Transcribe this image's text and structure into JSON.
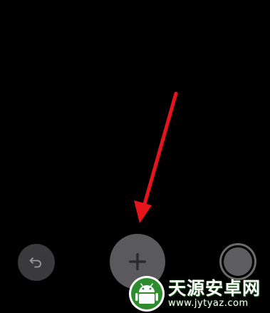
{
  "toolbar": {
    "undo": {
      "icon": "undo-arrow-icon"
    },
    "add": {
      "icon": "plus-icon"
    },
    "record": {
      "icon": "record-circle-icon"
    }
  },
  "annotation": {
    "arrow_color": "#e8141c"
  },
  "watermark": {
    "title": "天源安卓网",
    "url": "www.jytyaz.com",
    "logo_color": "#2e8b2e"
  },
  "colors": {
    "background": "#000000",
    "undo_button": "#3a3a3c",
    "add_button": "#5a5a5c",
    "icon": "#2a2a2c"
  }
}
